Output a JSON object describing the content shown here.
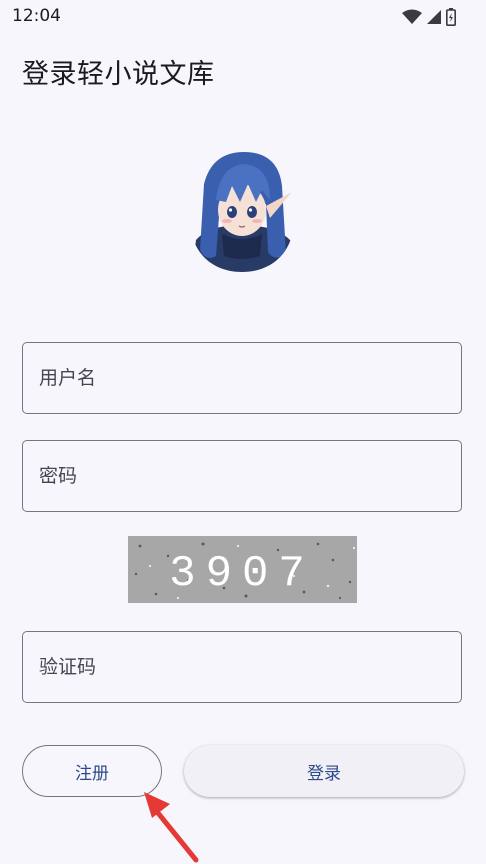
{
  "status_bar": {
    "time": "12:04",
    "icons": [
      "wifi-icon",
      "cellular-signal-icon",
      "battery-icon"
    ]
  },
  "header": {
    "title": "登录轻小说文库"
  },
  "form": {
    "username_placeholder": "用户名",
    "password_placeholder": "密码",
    "captcha_text": "3907",
    "captcha_placeholder": "验证码"
  },
  "buttons": {
    "register_label": "注册",
    "login_label": "登录"
  },
  "colors": {
    "background": "#f7f6fc",
    "button_text": "#2c4a8a",
    "outline": "#76767e",
    "annotation_arrow": "#e53935"
  }
}
